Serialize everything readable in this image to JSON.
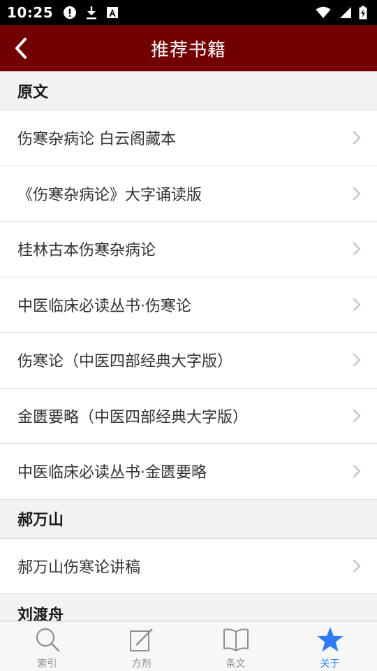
{
  "status_bar": {
    "time": "10:25"
  },
  "app_bar": {
    "title": "推荐书籍"
  },
  "sections": [
    {
      "header": "原文",
      "items": [
        "伤寒杂病论 白云阁藏本",
        "《伤寒杂病论》大字诵读版",
        "桂林古本伤寒杂病论",
        "中医临床必读丛书·伤寒论",
        "伤寒论（中医四部经典大字版）",
        "金匮要略（中医四部经典大字版）",
        "中医临床必读丛书·金匮要略"
      ]
    },
    {
      "header": "郝万山",
      "items": [
        "郝万山伤寒论讲稿"
      ]
    },
    {
      "header": "刘渡舟",
      "items": []
    }
  ],
  "tabs": [
    {
      "label": "索引",
      "icon": "search-icon",
      "active": false
    },
    {
      "label": "方剂",
      "icon": "edit-icon",
      "active": false
    },
    {
      "label": "条文",
      "icon": "book-icon",
      "active": false
    },
    {
      "label": "关于",
      "icon": "star-icon",
      "active": true
    }
  ],
  "colors": {
    "app_bar": "#730000",
    "active_tab": "#2f7bf5",
    "inactive_tab": "#8e8e93"
  }
}
